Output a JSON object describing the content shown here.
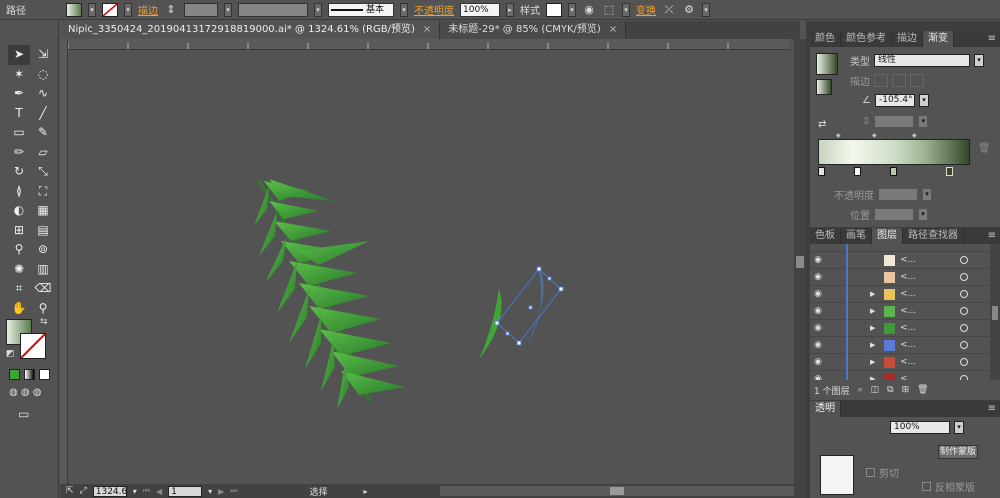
{
  "control_bar": {
    "selection_type": "路径",
    "stroke_link": "描边",
    "stroke_width": "",
    "brush_definition": "基本",
    "opacity_link": "不透明度",
    "opacity_value": "100%",
    "style_label": "样式",
    "transform_link": "变换"
  },
  "document_tabs": [
    {
      "title": "Nipic_3350424_20190413172918819000.ai* @ 1324.61% (RGB/预览)",
      "close": "×"
    },
    {
      "title": "未标题-29* @ 85% (CMYK/预览)",
      "close": "×"
    }
  ],
  "status_bar": {
    "zoom": "1324.6",
    "artboard": "1",
    "tool_status": "选择"
  },
  "color_panel": {
    "tabs": [
      "颜色",
      "颜色参考",
      "描边",
      "渐变"
    ],
    "active_tab": "渐变",
    "type_label": "类型",
    "type_value": "线性",
    "stroke_label": "描边",
    "angle_value": "-105.4°",
    "opacity_label": "不透明度",
    "location_label": "位置"
  },
  "layers_panel": {
    "tabs": [
      "色板",
      "画笔",
      "图层",
      "路径查找器"
    ],
    "active_tab": "图层",
    "row_label": "<...",
    "count_label": "1 个图层",
    "icons": [
      "locate-object-icon",
      "make-clipping-mask-icon",
      "new-sublayer-icon",
      "new-layer-icon",
      "delete-layer-icon"
    ]
  },
  "transparency_panel": {
    "tab": "透明",
    "opacity_value": "100%",
    "button_label": "制作蒙版",
    "clip_label": "剪切",
    "invert_label": "反相蒙版"
  },
  "colors": {
    "accent_link": "#f0a030",
    "layer_color": "#4a78d0",
    "leaf_green": "#3fa535",
    "gradient_light": "#e8f0e0",
    "gradient_dark": "#37482a"
  }
}
